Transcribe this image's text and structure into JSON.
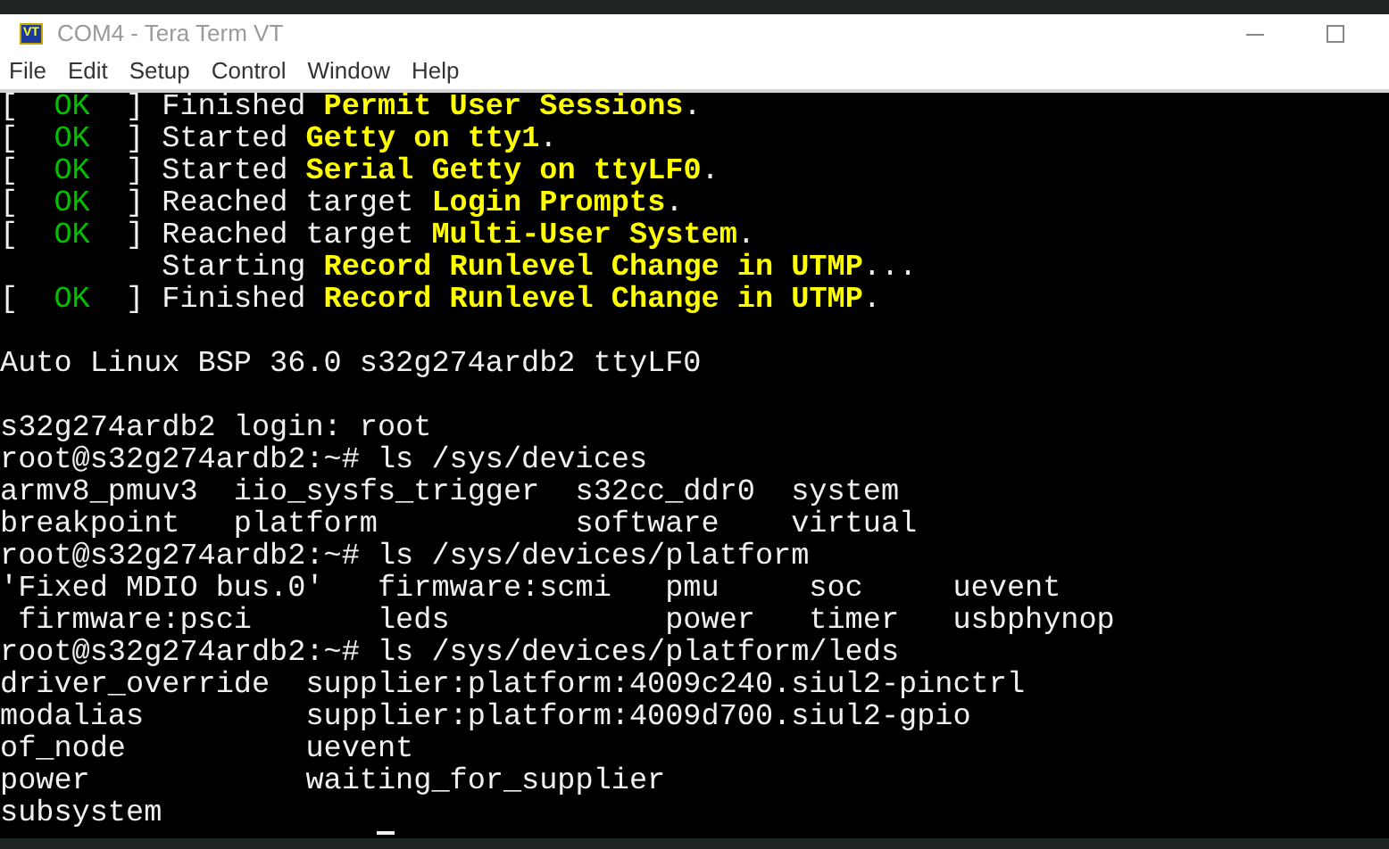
{
  "window": {
    "title": "COM4 - Tera Term VT",
    "icon_text": "VT"
  },
  "menu": [
    "File",
    "Edit",
    "Setup",
    "Control",
    "Window",
    "Help"
  ],
  "terminal": {
    "lines": [
      {
        "segments": [
          {
            "kind": "plain",
            "text": "[  "
          },
          {
            "kind": "ok",
            "text": "OK"
          },
          {
            "kind": "plain",
            "text": "  ] Finished "
          },
          {
            "kind": "highlight",
            "text": "Permit User Sessions"
          },
          {
            "kind": "plain",
            "text": "."
          }
        ]
      },
      {
        "segments": [
          {
            "kind": "plain",
            "text": "[  "
          },
          {
            "kind": "ok",
            "text": "OK"
          },
          {
            "kind": "plain",
            "text": "  ] Started "
          },
          {
            "kind": "highlight",
            "text": "Getty on tty1"
          },
          {
            "kind": "plain",
            "text": "."
          }
        ]
      },
      {
        "segments": [
          {
            "kind": "plain",
            "text": "[  "
          },
          {
            "kind": "ok",
            "text": "OK"
          },
          {
            "kind": "plain",
            "text": "  ] Started "
          },
          {
            "kind": "highlight",
            "text": "Serial Getty on ttyLF0"
          },
          {
            "kind": "plain",
            "text": "."
          }
        ]
      },
      {
        "segments": [
          {
            "kind": "plain",
            "text": "[  "
          },
          {
            "kind": "ok",
            "text": "OK"
          },
          {
            "kind": "plain",
            "text": "  ] Reached target "
          },
          {
            "kind": "highlight",
            "text": "Login Prompts"
          },
          {
            "kind": "plain",
            "text": "."
          }
        ]
      },
      {
        "segments": [
          {
            "kind": "plain",
            "text": "[  "
          },
          {
            "kind": "ok",
            "text": "OK"
          },
          {
            "kind": "plain",
            "text": "  ] Reached target "
          },
          {
            "kind": "highlight",
            "text": "Multi-User System"
          },
          {
            "kind": "plain",
            "text": "."
          }
        ]
      },
      {
        "segments": [
          {
            "kind": "plain",
            "text": "         Starting "
          },
          {
            "kind": "highlight",
            "text": "Record Runlevel Change in UTMP"
          },
          {
            "kind": "plain",
            "text": "..."
          }
        ]
      },
      {
        "segments": [
          {
            "kind": "plain",
            "text": "[  "
          },
          {
            "kind": "ok",
            "text": "OK"
          },
          {
            "kind": "plain",
            "text": "  ] Finished "
          },
          {
            "kind": "highlight",
            "text": "Record Runlevel Change in UTMP"
          },
          {
            "kind": "plain",
            "text": "."
          }
        ]
      },
      {
        "kind": "blank"
      },
      {
        "segments": [
          {
            "kind": "plain",
            "text": "Auto Linux BSP 36.0 s32g274ardb2 ttyLF0"
          }
        ]
      },
      {
        "kind": "blank"
      },
      {
        "segments": [
          {
            "kind": "plain",
            "text": "s32g274ardb2 login: root"
          }
        ]
      },
      {
        "segments": [
          {
            "kind": "plain",
            "text": "root@s32g274ardb2:~# ls /sys/devices"
          }
        ]
      },
      {
        "segments": [
          {
            "kind": "plain",
            "text": "armv8_pmuv3  iio_sysfs_trigger  s32cc_ddr0  system"
          }
        ]
      },
      {
        "segments": [
          {
            "kind": "plain",
            "text": "breakpoint   platform           software    virtual"
          }
        ]
      },
      {
        "segments": [
          {
            "kind": "plain",
            "text": "root@s32g274ardb2:~# ls /sys/devices/platform"
          }
        ]
      },
      {
        "segments": [
          {
            "kind": "plain",
            "text": "'Fixed MDIO bus.0'   firmware:scmi   pmu     soc     uevent"
          }
        ]
      },
      {
        "segments": [
          {
            "kind": "plain",
            "text": " firmware:psci       leds            power   timer   usbphynop"
          }
        ]
      },
      {
        "segments": [
          {
            "kind": "plain",
            "text": "root@s32g274ardb2:~# ls /sys/devices/platform/leds"
          }
        ]
      },
      {
        "segments": [
          {
            "kind": "plain",
            "text": "driver_override  supplier:platform:4009c240.siul2-pinctrl"
          }
        ]
      },
      {
        "segments": [
          {
            "kind": "plain",
            "text": "modalias         supplier:platform:4009d700.siul2-gpio"
          }
        ]
      },
      {
        "segments": [
          {
            "kind": "plain",
            "text": "of_node          uevent"
          }
        ]
      },
      {
        "segments": [
          {
            "kind": "plain",
            "text": "power            waiting_for_supplier"
          }
        ]
      },
      {
        "segments": [
          {
            "kind": "plain",
            "text": "subsystem"
          }
        ]
      }
    ]
  }
}
